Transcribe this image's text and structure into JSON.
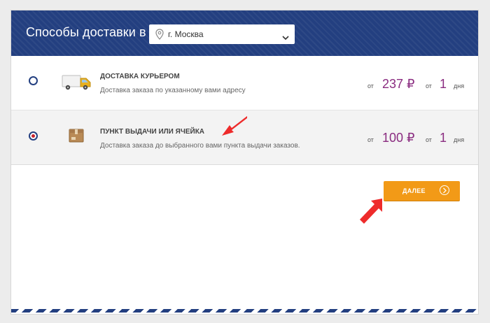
{
  "header": {
    "title": "Способы доставки в",
    "city_select": {
      "value": "г. Москва",
      "icon": "map-pin-icon"
    }
  },
  "options": [
    {
      "title": "ДОСТАВКА КУРЬЕРОМ",
      "description": "Доставка заказа по указанному вами адресу",
      "price_prefix": "от",
      "price": "237 ₽",
      "days_prefix": "от",
      "days": "1",
      "days_unit": "дня",
      "selected": false,
      "icon": "delivery-truck-icon"
    },
    {
      "title": "ПУНКТ ВЫДАЧИ ИЛИ ЯЧЕЙКА",
      "description": "Доставка заказа до выбранного вами пункта выдачи заказов.",
      "price_prefix": "от",
      "price": "100 ₽",
      "days_prefix": "от",
      "days": "1",
      "days_unit": "дня",
      "selected": true,
      "icon": "parcel-box-icon"
    }
  ],
  "next_button": {
    "label": "ДАЛЕЕ",
    "icon": "arrow-right-circle-icon"
  },
  "colors": {
    "header_blue": "#233f80",
    "price_purple": "#8a2c80",
    "button_orange": "#f29a17",
    "radio_selected": "#c8232c",
    "annotation_arrow": "#ee2b2b"
  }
}
